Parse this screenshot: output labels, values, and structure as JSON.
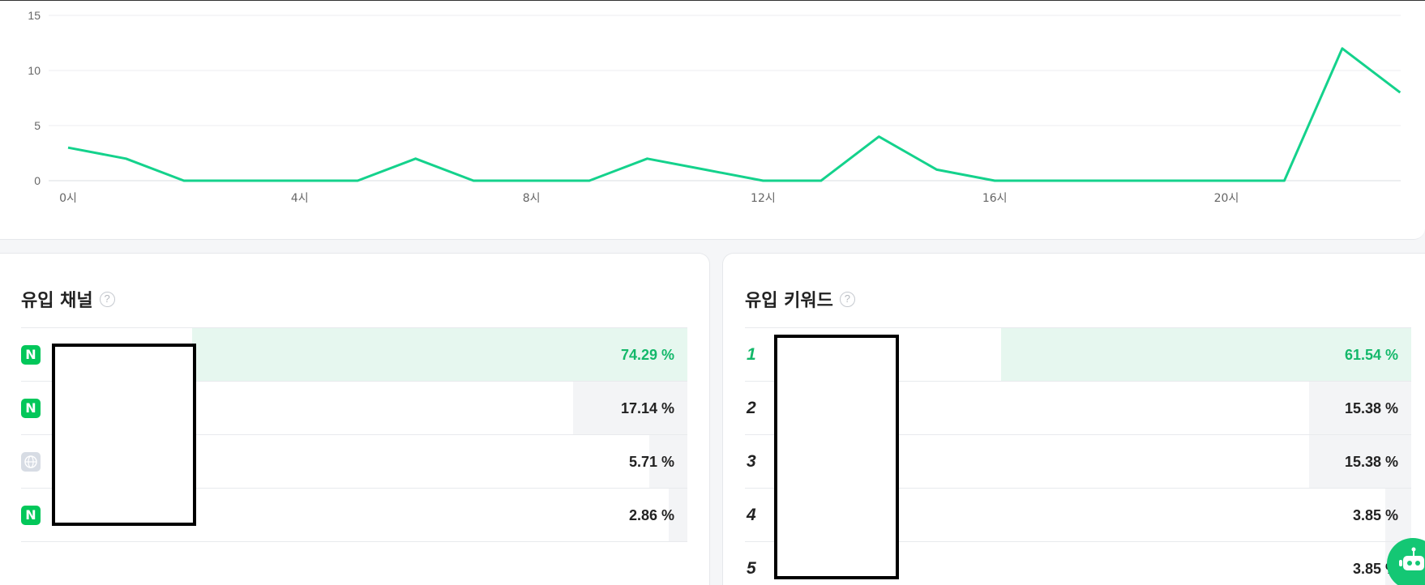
{
  "chart_data": {
    "type": "line",
    "x": [
      0,
      1,
      2,
      3,
      4,
      5,
      6,
      7,
      8,
      9,
      10,
      11,
      12,
      13,
      14,
      15,
      16,
      17,
      18,
      19,
      20,
      21,
      22,
      23
    ],
    "series": [
      {
        "values": [
          3,
          2,
          0,
          0,
          0,
          0,
          2,
          0,
          0,
          0,
          2,
          1,
          0,
          0,
          4,
          1,
          0,
          0,
          0,
          0,
          0,
          0,
          12,
          8
        ]
      }
    ],
    "y_ticks": [
      "0",
      "5",
      "10",
      "15"
    ],
    "x_ticks": [
      "0시",
      "4시",
      "8시",
      "12시",
      "16시",
      "20시"
    ],
    "x_tick_hours": [
      0,
      4,
      8,
      12,
      16,
      20
    ],
    "ylim": [
      0,
      15
    ],
    "grid": true,
    "line_color": "#14d28c"
  },
  "channels": {
    "title": "유입 채널",
    "help": "?",
    "rows": [
      {
        "icon": "naver-icon",
        "icon_text": "N",
        "percent": "74.29 %",
        "share": 0.7429
      },
      {
        "icon": "naver-icon",
        "icon_text": "N",
        "percent": "17.14 %",
        "share": 0.1714
      },
      {
        "icon": "globe-icon",
        "icon_text": "",
        "percent": "5.71 %",
        "share": 0.0571
      },
      {
        "icon": "naver-icon",
        "icon_text": "N",
        "percent": "2.86 %",
        "share": 0.0286
      }
    ]
  },
  "keywords": {
    "title": "유입 키워드",
    "help": "?",
    "rows": [
      {
        "rank": "1",
        "percent": "61.54 %",
        "share": 0.6154
      },
      {
        "rank": "2",
        "percent": "15.38 %",
        "share": 0.1538
      },
      {
        "rank": "3",
        "percent": "15.38 %",
        "share": 0.1538
      },
      {
        "rank": "4",
        "percent": "3.85 %",
        "share": 0.0385
      },
      {
        "rank": "5",
        "percent": "3.85 %",
        "share": 0.0385
      }
    ]
  },
  "colors": {
    "accent": "#14b86a",
    "naver": "#03c75a",
    "top_bar": "#e6f7ef",
    "bar": "#f3f4f6"
  }
}
